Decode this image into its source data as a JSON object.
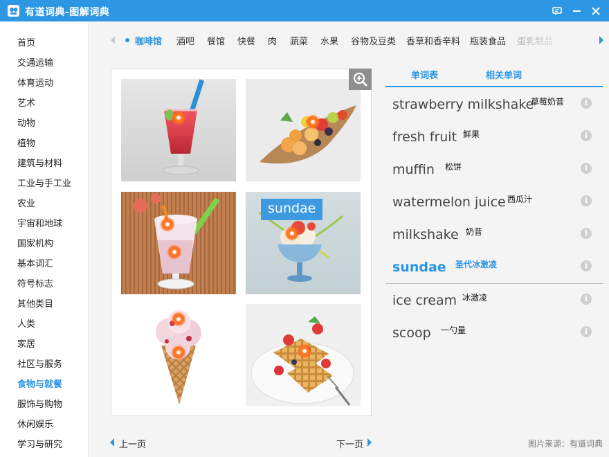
{
  "window": {
    "title": "有道词典-图解词典",
    "logo_icon": "youdao-logo-icon",
    "buttons": [
      "feedback-icon",
      "minimize-icon",
      "close-icon"
    ],
    "titlebar_color": "#2e97e3"
  },
  "sidebar": {
    "items": [
      "首页",
      "交通运输",
      "体育运动",
      "艺术",
      "动物",
      "植物",
      "建筑与材料",
      "工业与手工业",
      "农业",
      "宇宙和地球",
      "国家机构",
      "基本词汇",
      "符号标志",
      "其他类目",
      "人类",
      "家居",
      "社区与服务",
      "食物与就餐",
      "服饰与购物",
      "休闲娱乐",
      "学习与研究"
    ],
    "active": "食物与就餐"
  },
  "tabs": {
    "items": [
      "咖啡馆",
      "酒吧",
      "餐馆",
      "快餐",
      "肉",
      "蔬菜",
      "水果",
      "谷物及豆类",
      "香草和香辛料",
      "瓶装食品",
      "蛋乳制品"
    ],
    "active": "咖啡馆"
  },
  "gallery": {
    "images": [
      "strawberry milkshake",
      "fresh fruit",
      "milkshake",
      "sundae",
      "ice cream",
      "waffle"
    ],
    "selected_label": "sundae",
    "zoom_icon": "zoom-in-icon"
  },
  "pager": {
    "prev": "上一页",
    "next": "下一页"
  },
  "words": {
    "tabs": [
      "单词表",
      "相关单词"
    ],
    "active_tab": "单词表",
    "items": [
      {
        "en": "strawberry milkshake",
        "cn": "草莓奶昔"
      },
      {
        "en": "fresh fruit",
        "cn": "鲜果"
      },
      {
        "en": "muffin",
        "cn": "松饼"
      },
      {
        "en": "watermelon juice",
        "cn": "西瓜汁"
      },
      {
        "en": "milkshake",
        "cn": "奶昔"
      },
      {
        "en": "sundae",
        "cn": "圣代冰激凌"
      },
      {
        "en": "ice cream",
        "cn": "冰激凌"
      },
      {
        "en": "scoop",
        "cn": "一勺量"
      }
    ],
    "active": "sundae",
    "info_icon": "i"
  },
  "source": "图片来源：有道词典",
  "accent": "#2b95e2"
}
